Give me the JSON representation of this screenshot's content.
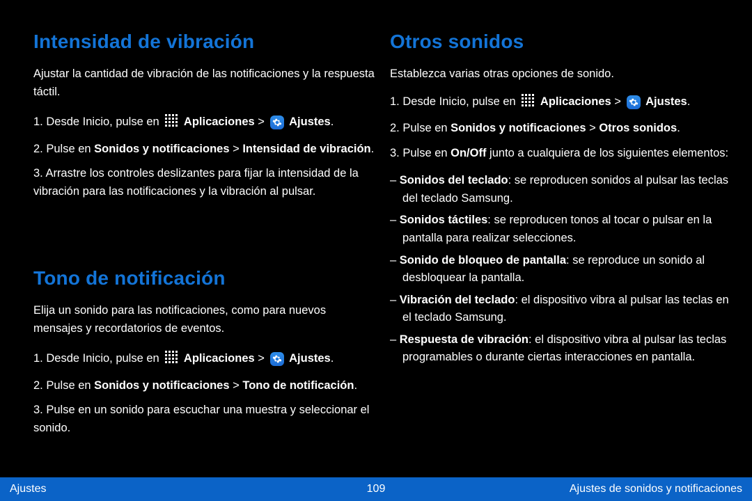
{
  "left": {
    "section1": {
      "heading": "Intensidad de vibración",
      "intro": "Ajustar la cantidad de vibración de las notificaciones y la respuesta táctil.",
      "steps_prefix": "Desde Inicio, pulse en",
      "apps_label": "Aplicaciones",
      "settings_label": "Ajustes",
      "path": "Sonidos y notificaciones",
      "path_end": "Intensidad de vibración",
      "tail": "Arrastre los controles deslizantes para fijar la intensidad de la vibración para las notificaciones y la vibración al pulsar."
    },
    "section2": {
      "heading": "Tono de notificación",
      "intro": "Elija un sonido para las notificaciones, como para nuevos mensajes y recordatorios de eventos.",
      "steps_prefix": "Desde Inicio, pulse en",
      "apps_label": "Aplicaciones",
      "settings_label": "Ajustes",
      "path": "Sonidos y notificaciones",
      "path_end": "Tono de notificación",
      "tail": "Pulse en un sonido para escuchar una muestra y seleccionar el sonido."
    }
  },
  "right": {
    "section1": {
      "heading": "Otros sonidos",
      "intro": "Establezca varias otras opciones de sonido.",
      "steps_prefix": "Desde Inicio, pulse en",
      "apps_label": "Aplicaciones",
      "settings_label": "Ajustes",
      "path": "Sonidos y notificaciones",
      "path_end": "Otros sonidos",
      "bullets": [
        {
          "label": "Sonidos del teclado",
          "desc": "se reproducen sonidos al pulsar las teclas del teclado Samsung."
        },
        {
          "label": "Sonidos táctiles",
          "desc": "se reproducen tonos al tocar o pulsar en la pantalla para realizar selecciones."
        },
        {
          "label": "Sonido de bloqueo de pantalla",
          "desc": "se reproduce un sonido al desbloquear la pantalla."
        },
        {
          "label": "Vibración del teclado",
          "desc": "el dispositivo vibra al pulsar las teclas en el teclado Samsung."
        },
        {
          "label": "Respuesta de vibración",
          "desc": "el dispositivo vibra al pulsar las teclas programables o durante ciertas interacciones en pantalla."
        }
      ]
    }
  },
  "footer": {
    "left": "Ajustes",
    "center": "109",
    "right": "Ajustes de sonidos y notificaciones"
  },
  "glyph": {
    "arrow": " > "
  }
}
